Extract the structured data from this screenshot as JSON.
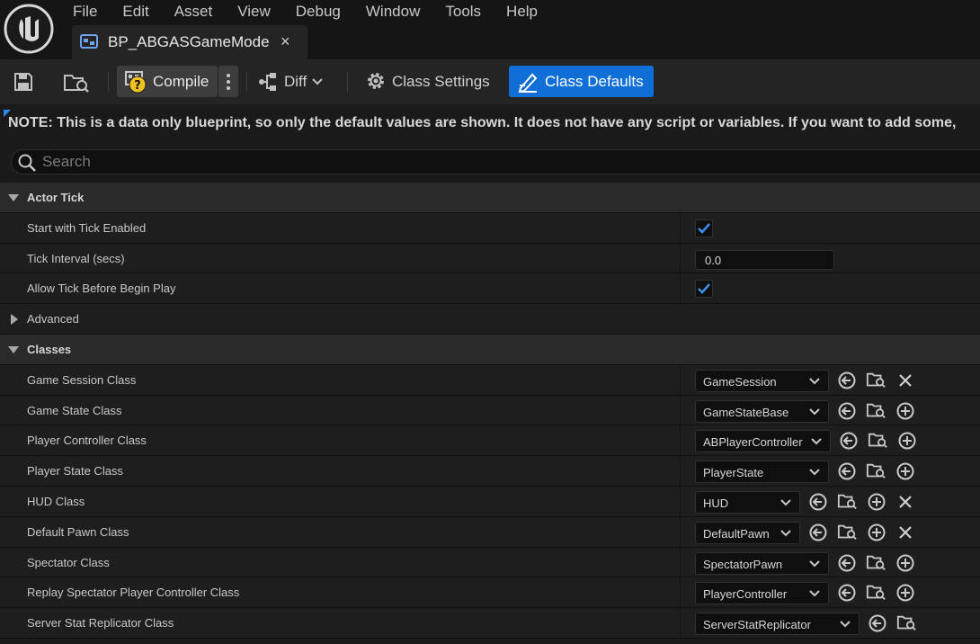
{
  "menu": [
    "File",
    "Edit",
    "Asset",
    "View",
    "Debug",
    "Window",
    "Tools",
    "Help"
  ],
  "tab": {
    "title": "BP_ABGASGameMode",
    "close": "×"
  },
  "toolbar": {
    "compile_label": "Compile",
    "diff_label": "Diff",
    "class_settings_label": "Class Settings",
    "class_defaults_label": "Class Defaults"
  },
  "note": "NOTE: This is a data only blueprint, so only the default values are shown.  It does not have any script or variables.  If you want to add some, ",
  "search": {
    "placeholder": "Search",
    "value": ""
  },
  "categories": {
    "actor_tick": {
      "label": "Actor Tick",
      "start_with_tick_enabled": {
        "label": "Start with Tick Enabled",
        "checked": true
      },
      "tick_interval": {
        "label": "Tick Interval (secs)",
        "value": "0.0"
      },
      "allow_tick_before_begin_play": {
        "label": "Allow Tick Before Begin Play",
        "checked": true
      },
      "advanced": {
        "label": "Advanced"
      }
    },
    "classes": {
      "label": "Classes",
      "items": [
        {
          "label": "Game Session Class",
          "value": "GameSession",
          "clear": true
        },
        {
          "label": "Game State Class",
          "value": "GameStateBase",
          "clear": false
        },
        {
          "label": "Player Controller Class",
          "value": "ABPlayerController",
          "clear": false
        },
        {
          "label": "Player State Class",
          "value": "PlayerState",
          "clear": false
        },
        {
          "label": "HUD Class",
          "value": "HUD",
          "clear": true,
          "add": true
        },
        {
          "label": "Default Pawn Class",
          "value": "DefaultPawn",
          "clear": true,
          "add": true
        },
        {
          "label": "Spectator Class",
          "value": "SpectatorPawn",
          "clear": false
        },
        {
          "label": "Replay Spectator Player Controller Class",
          "value": "PlayerController",
          "clear": false
        },
        {
          "label": "Server Stat Replicator Class",
          "value": "ServerStatReplicator",
          "clear": false
        }
      ]
    }
  },
  "colors": {
    "accent": "#0f6fd6",
    "checkmark": "#3b8fe8",
    "warning": "#f0c020"
  }
}
